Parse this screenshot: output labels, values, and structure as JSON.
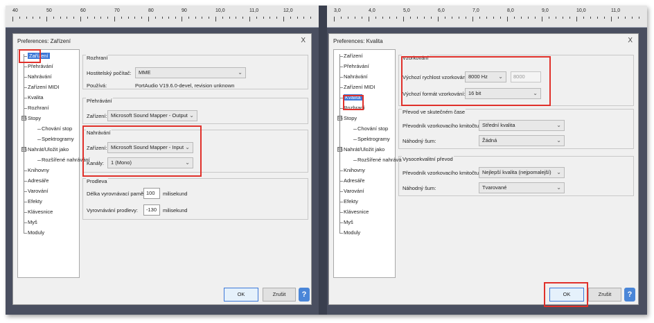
{
  "ruler": {
    "left_ticks": [
      "40",
      "50",
      "60",
      "70",
      "80",
      "90",
      "10,0",
      "11,0",
      "12,0"
    ],
    "right_ticks": [
      "3,0",
      "4,0",
      "5,0",
      "6,0",
      "7,0",
      "8,0",
      "9,0",
      "10,0",
      "11,0"
    ]
  },
  "left_dialog": {
    "title": "Preferences: Zařízení",
    "close": "X",
    "tree": [
      "Zařízení",
      "Přehrávání",
      "Nahrávání",
      "Zařízení MIDI",
      "Kvalita",
      "Rozhraní",
      "Stopy",
      "Chování stop",
      "Spektrogramy",
      "Nahrát/Uložit jako",
      "Rozšířené nahrávání",
      "Knihovny",
      "Adresáře",
      "Varování",
      "Efekty",
      "Klávesnice",
      "Myš",
      "Moduly"
    ],
    "tree_toggle": "⊟",
    "interface": {
      "title": "Rozhraní",
      "host_label": "Hostitelský počítač:",
      "host_value": "MME",
      "using_label": "Používá:",
      "using_value": "PortAudio V19.6.0-devel, revision unknown"
    },
    "playback": {
      "title": "Přehrávání",
      "device_label": "Zařízení:",
      "device_value": "Microsoft Sound Mapper - Output"
    },
    "recording": {
      "title": "Nahrávání",
      "device_label": "Zařízení:",
      "device_value": "Microsoft Sound Mapper - Input",
      "channels_label": "Kanály:",
      "channels_value": "1 (Mono)"
    },
    "latency": {
      "title": "Prodleva",
      "buffer_label": "Délka vyrovnávací paměti:",
      "buffer_value": "100",
      "buffer_unit": "milisekund",
      "comp_label": "Vyrovnávání prodlevy:",
      "comp_value": "-130",
      "comp_unit": "milisekund"
    },
    "ok": "OK",
    "cancel": "Zrušit",
    "help": "?"
  },
  "right_dialog": {
    "title": "Preferences: Kvalita",
    "close": "X",
    "tree": [
      "Zařízení",
      "Přehrávání",
      "Nahrávání",
      "Zařízení MIDI",
      "Kvalita",
      "Rozhraní",
      "Stopy",
      "Chování stop",
      "Spektrogramy",
      "Nahrát/Uložit jako",
      "Rozšířené nahrávání",
      "Knihovny",
      "Adresáře",
      "Varování",
      "Efekty",
      "Klávesnice",
      "Myš",
      "Moduly"
    ],
    "tree_toggle": "⊟",
    "sampling": {
      "title": "Vzorkování",
      "rate_label": "Výchozí rychlost vzorkování:",
      "rate_value": "8000 Hz",
      "rate_custom": "8000",
      "format_label": "Výchozí formát vzorkování:",
      "format_value": "16 bit"
    },
    "rt_conversion": {
      "title": "Převod ve skutečném čase",
      "converter_label": "Převodník vzorkovacího kmitočtu:",
      "converter_value": "Střední kvalita",
      "dither_label": "Náhodný šum:",
      "dither_value": "Žádná"
    },
    "hq_conversion": {
      "title": "Vysocekvalitní převod",
      "converter_label": "Převodník vzorkovacího kmitočtu:",
      "converter_value": "Nejlepší kvalita (nejpomalejší)",
      "dither_label": "Náhodný šum:",
      "dither_value": "Tvarované"
    },
    "ok": "OK",
    "cancel": "Zrušit",
    "help": "?"
  },
  "colors": {
    "highlight": "#e0302a",
    "selection": "#3c78d8"
  }
}
